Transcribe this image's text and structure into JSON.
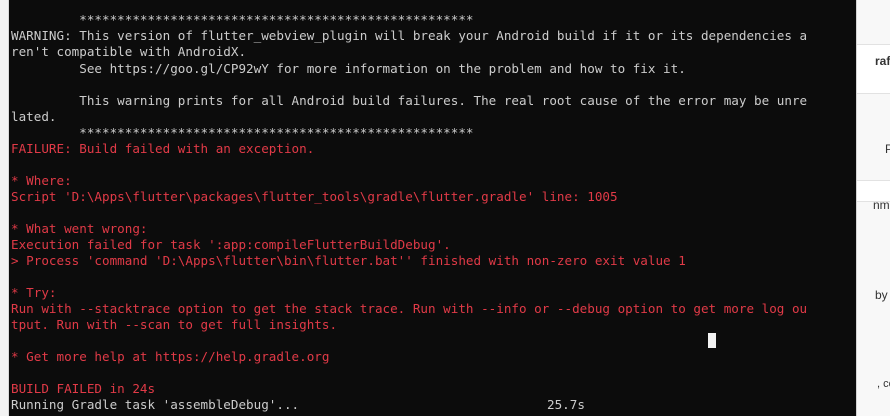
{
  "terminal": {
    "lines": [
      {
        "text": "         ****************************************************",
        "color": "white"
      },
      {
        "text": "WARNING: This version of flutter_webview_plugin will break your Android build if it or its dependencies a",
        "color": "white"
      },
      {
        "text": "ren't compatible with AndroidX.",
        "color": "white"
      },
      {
        "text": "         See https://goo.gl/CP92wY for more information on the problem and how to fix it.",
        "color": "white"
      },
      {
        "text": "",
        "color": "white"
      },
      {
        "text": "         This warning prints for all Android build failures. The real root cause of the error may be unre",
        "color": "white"
      },
      {
        "text": "lated.",
        "color": "white"
      },
      {
        "text": "         ****************************************************",
        "color": "white"
      },
      {
        "text": "FAILURE: Build failed with an exception.",
        "color": "red"
      },
      {
        "text": "",
        "color": "red"
      },
      {
        "text": "* Where:",
        "color": "red"
      },
      {
        "text": "Script 'D:\\Apps\\flutter\\packages\\flutter_tools\\gradle\\flutter.gradle' line: 1005",
        "color": "red"
      },
      {
        "text": "",
        "color": "red"
      },
      {
        "text": "* What went wrong:",
        "color": "red"
      },
      {
        "text": "Execution failed for task ':app:compileFlutterBuildDebug'.",
        "color": "red"
      },
      {
        "text": "> Process 'command 'D:\\Apps\\flutter\\bin\\flutter.bat'' finished with non-zero exit value 1",
        "color": "red"
      },
      {
        "text": "",
        "color": "red"
      },
      {
        "text": "* Try:",
        "color": "red"
      },
      {
        "text": "Run with --stacktrace option to get the stack trace. Run with --info or --debug option to get more log ou",
        "color": "red"
      },
      {
        "text": "tput. Run with --scan to get full insights.",
        "color": "red"
      },
      {
        "text": "",
        "color": "red"
      },
      {
        "text": "* Get more help at https://help.gradle.org",
        "color": "red"
      },
      {
        "text": "",
        "color": "red"
      },
      {
        "text": "BUILD FAILED in 24s",
        "color": "red"
      },
      {
        "text": "Running Gradle task 'assembleDebug'...",
        "color": "white"
      }
    ],
    "elapsed": "25.7s",
    "colors": {
      "background": "#0c0c0c",
      "white": "#cccccc",
      "red": "#e13a47"
    }
  },
  "right_panel": {
    "fragments": [
      "raf",
      "nm",
      "P",
      "by",
      ", cc"
    ]
  }
}
